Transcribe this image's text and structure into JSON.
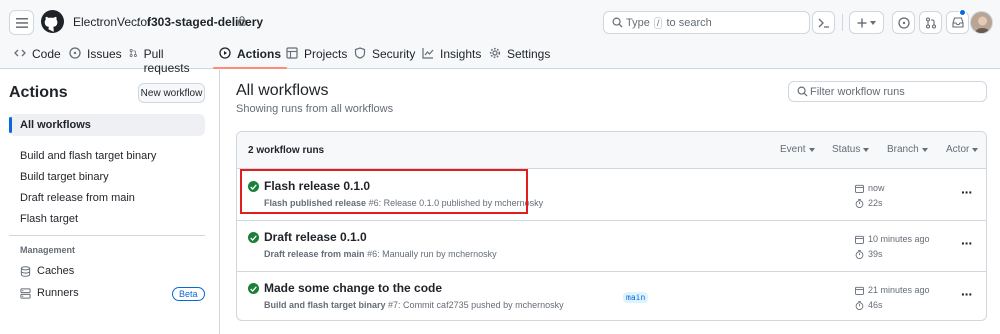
{
  "header": {
    "owner": "ElectronVector",
    "separator": "/",
    "repo": "f303-staged-delivery",
    "search_prefix": "Type",
    "search_key": "/",
    "search_suffix": "to search"
  },
  "tabs": [
    {
      "label": "Code",
      "icon": "code-icon"
    },
    {
      "label": "Issues",
      "icon": "issue-icon"
    },
    {
      "label": "Pull requests",
      "icon": "git-pull-request-icon"
    },
    {
      "label": "Actions",
      "icon": "play-icon",
      "active": true
    },
    {
      "label": "Projects",
      "icon": "table-icon"
    },
    {
      "label": "Security",
      "icon": "shield-icon"
    },
    {
      "label": "Insights",
      "icon": "graph-icon"
    },
    {
      "label": "Settings",
      "icon": "gear-icon"
    }
  ],
  "sidebar": {
    "title": "Actions",
    "new_workflow": "New workflow",
    "all_workflows": "All workflows",
    "workflows": [
      "Build and flash target binary",
      "Build target binary",
      "Draft release from main",
      "Flash target"
    ],
    "management_label": "Management",
    "caches": "Caches",
    "runners": "Runners",
    "beta": "Beta"
  },
  "main": {
    "title": "All workflows",
    "subtitle": "Showing runs from all workflows",
    "filter_placeholder": "Filter workflow runs",
    "runs_count": "2 workflow runs",
    "filters": [
      "Event",
      "Status",
      "Branch",
      "Actor"
    ],
    "runs": [
      {
        "title": "Flash release 0.1.0",
        "workflow": "Flash published release",
        "detail": "#6: Release 0.1.0 published by mchernosky",
        "time": "now",
        "duration": "22s",
        "branch": ""
      },
      {
        "title": "Draft release 0.1.0",
        "workflow": "Draft release from main",
        "detail": "#6: Manually run by mchernosky",
        "time": "10 minutes ago",
        "duration": "39s",
        "branch": ""
      },
      {
        "title": "Made some change to the code",
        "workflow": "Build and flash target binary",
        "detail": "#7: Commit caf2735 pushed by mchernosky",
        "time": "21 minutes ago",
        "duration": "46s",
        "branch": "main"
      }
    ]
  },
  "colors": {
    "accent": "#0969da",
    "success": "#1a7f37",
    "tab_underline": "#fd8c73",
    "highlight": "#e11d1d"
  }
}
